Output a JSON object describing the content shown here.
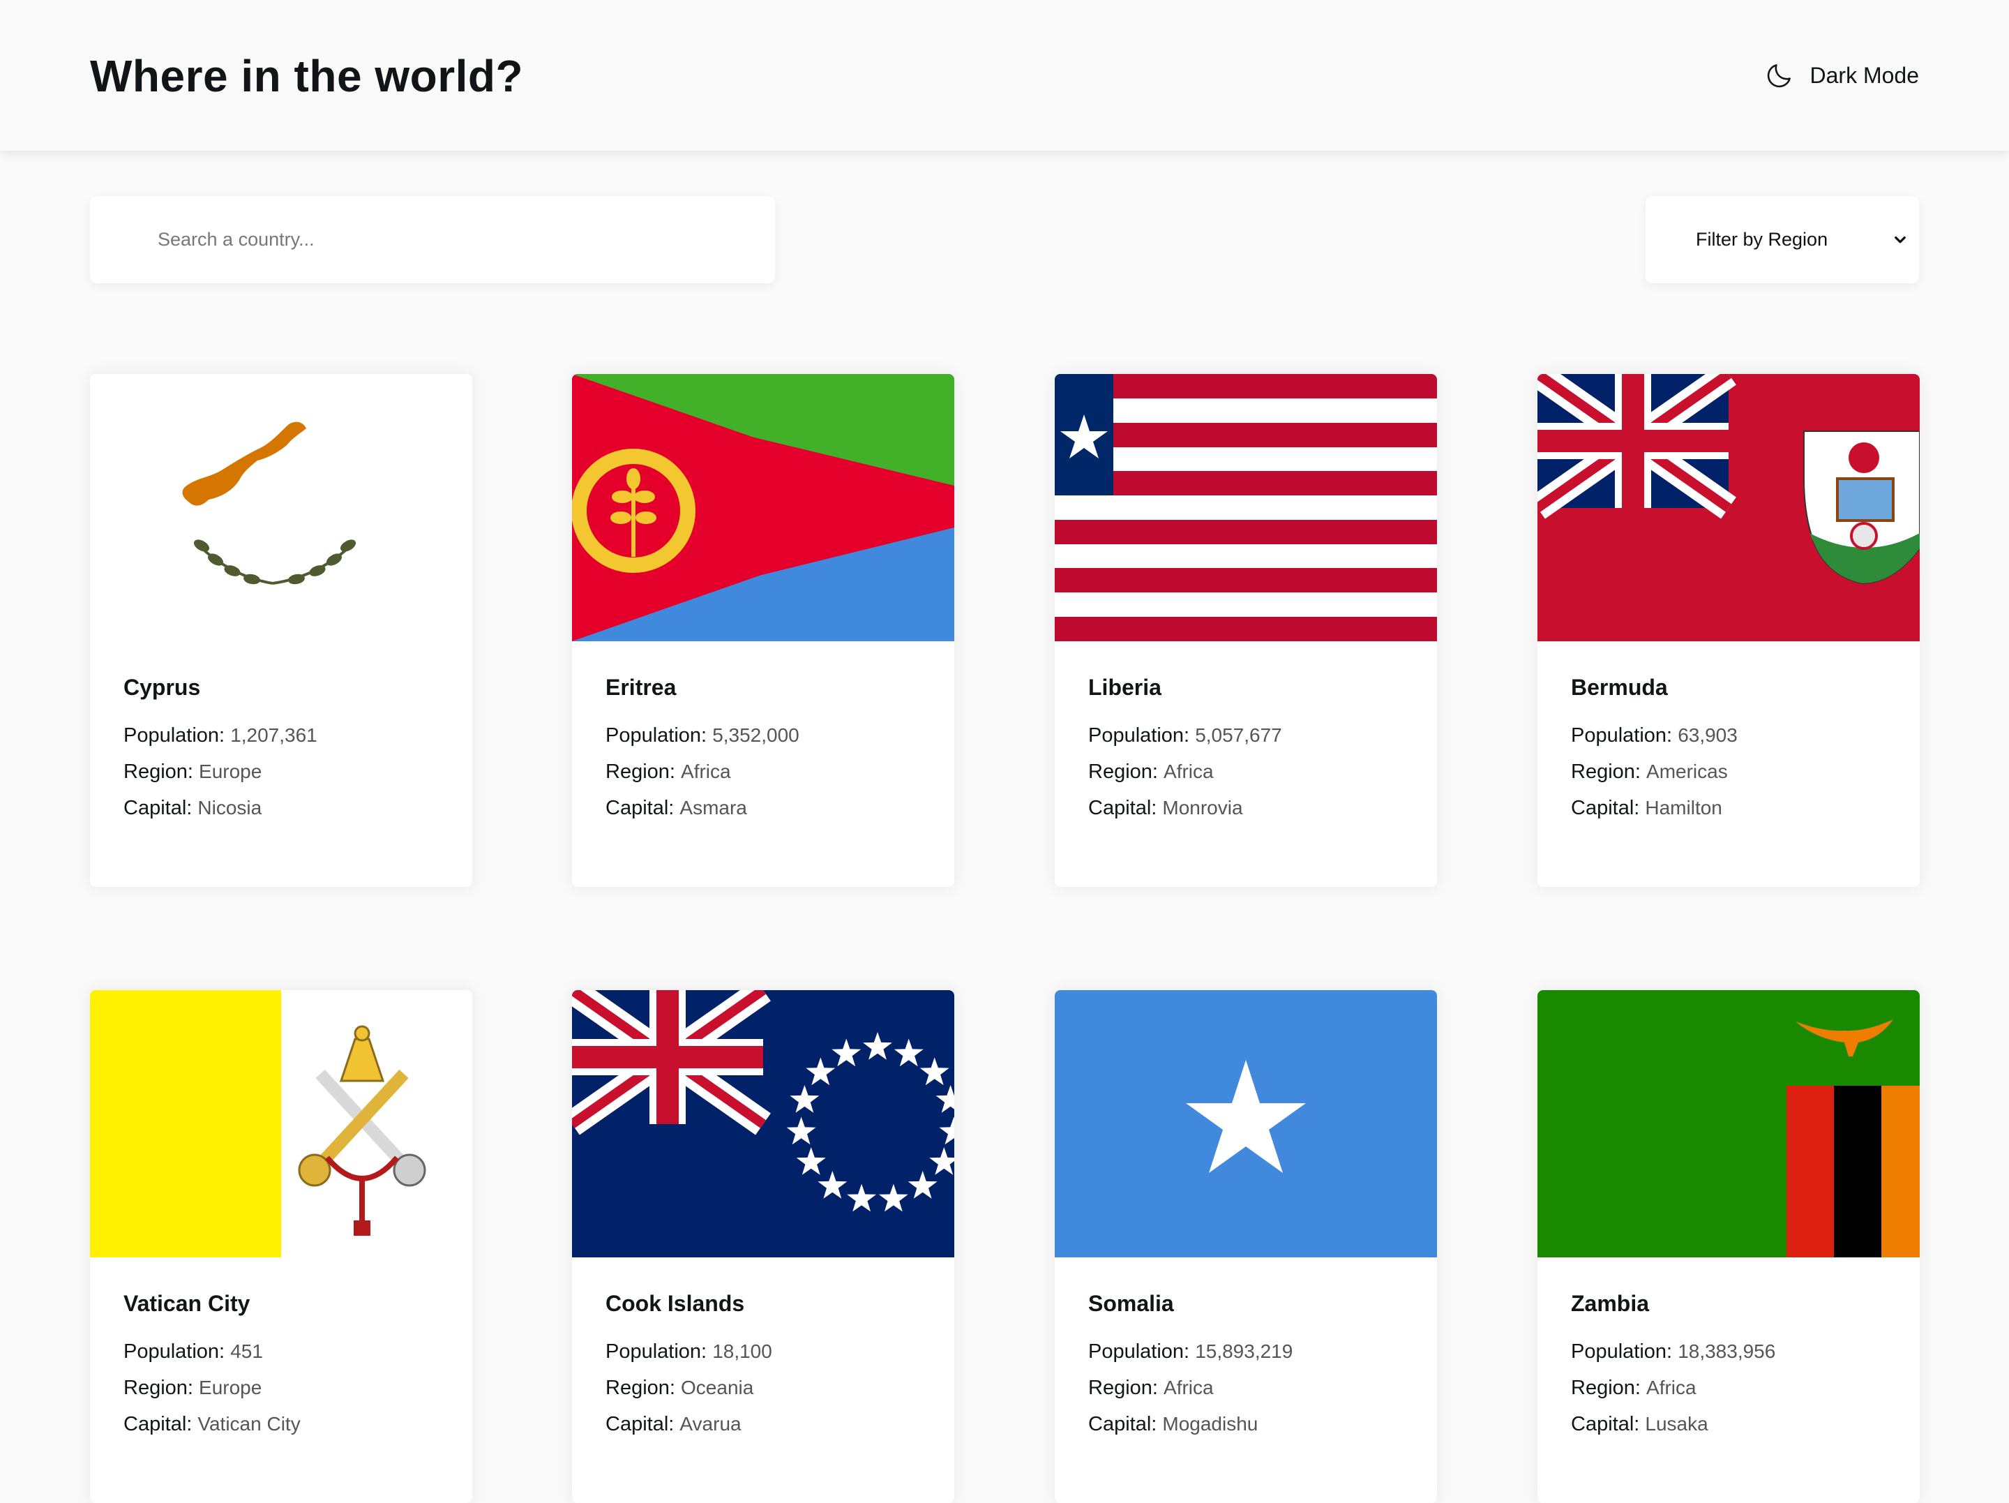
{
  "header": {
    "title": "Where in the world?",
    "dark_mode_label": "Dark Mode",
    "dark_mode_icon": "moon-icon"
  },
  "search": {
    "placeholder": "Search a country...",
    "icon": "search-icon"
  },
  "filter": {
    "label": "Filter by Region",
    "icon": "chevron-down-icon"
  },
  "labels": {
    "population": "Population:",
    "region": "Region:",
    "capital": "Capital:"
  },
  "countries": [
    {
      "name": "Cyprus",
      "population": "1,207,361",
      "region": "Europe",
      "capital": "Nicosia",
      "flag": "cyprus-flag"
    },
    {
      "name": "Eritrea",
      "population": "5,352,000",
      "region": "Africa",
      "capital": "Asmara",
      "flag": "eritrea-flag"
    },
    {
      "name": "Liberia",
      "population": "5,057,677",
      "region": "Africa",
      "capital": "Monrovia",
      "flag": "liberia-flag"
    },
    {
      "name": "Bermuda",
      "population": "63,903",
      "region": "Americas",
      "capital": "Hamilton",
      "flag": "bermuda-flag"
    },
    {
      "name": "Vatican City",
      "population": "451",
      "region": "Europe",
      "capital": "Vatican City",
      "flag": "vatican-flag"
    },
    {
      "name": "Cook Islands",
      "population": "18,100",
      "region": "Oceania",
      "capital": "Avarua",
      "flag": "cook-islands-flag"
    },
    {
      "name": "Somalia",
      "population": "15,893,219",
      "region": "Africa",
      "capital": "Mogadishu",
      "flag": "somalia-flag"
    },
    {
      "name": "Zambia",
      "population": "18,383,956",
      "region": "Africa",
      "capital": "Lusaka",
      "flag": "zambia-flag"
    }
  ]
}
